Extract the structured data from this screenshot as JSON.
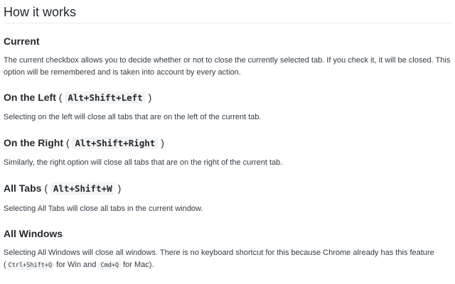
{
  "page": {
    "title": "How it works"
  },
  "sections": {
    "current": {
      "heading": "Current",
      "text": "The current checkbox allows you to decide whether or not to close the currently selected tab. If you check it, it will be closed. This option will be remembered and is taken into account by every action."
    },
    "left": {
      "heading": "On the Left",
      "shortcut": "Alt+Shift+Left",
      "text": "Selecting on the left will close all tabs that are on the left of the current tab."
    },
    "right": {
      "heading": "On the Right",
      "shortcut": "Alt+Shift+Right",
      "text": "Similarly, the right option will close all tabs that are on the right of the current tab."
    },
    "all_tabs": {
      "heading": "All Tabs",
      "shortcut": "Alt+Shift+W",
      "text": "Selecting All Tabs will close all tabs in the current window."
    },
    "all_windows": {
      "heading": "All Windows",
      "text_1": "Selecting All Windows will close all windows. There is no keyboard shortcut for this because Chrome already has this feature",
      "win_shortcut": "Ctrl+Shift+Q",
      "text_2": "for Win and",
      "mac_shortcut": "Cmd+Q",
      "text_3": "for Mac)."
    }
  }
}
